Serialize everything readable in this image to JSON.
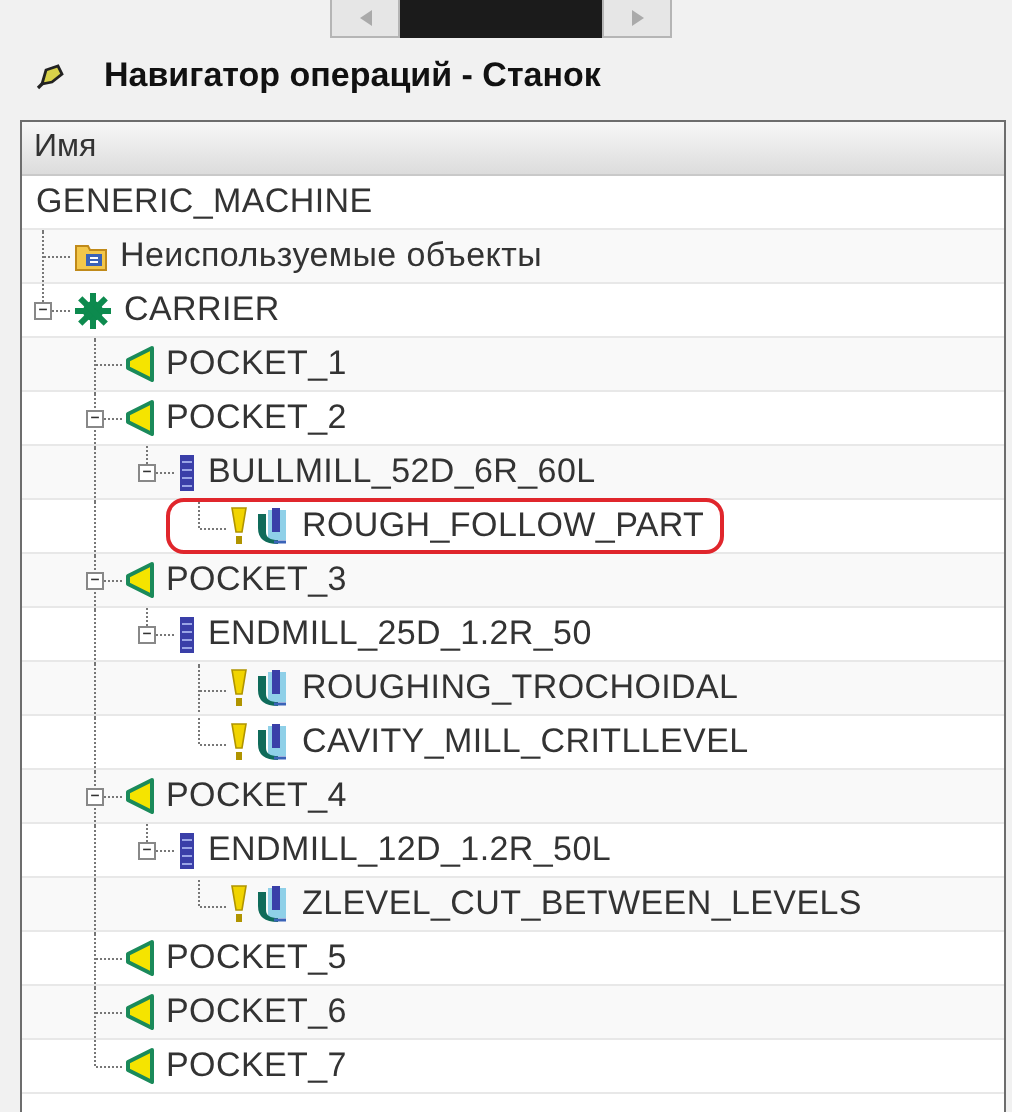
{
  "navigator": {
    "title": "Навигатор операций - Станок"
  },
  "tree": {
    "column": "Имя",
    "root": {
      "label": "GENERIC_MACHINE",
      "children": [
        {
          "kind": "unused",
          "label": "Неиспользуемые объекты"
        },
        {
          "kind": "carrier",
          "label": "CARRIER",
          "expanded": true,
          "children": [
            {
              "kind": "geometry",
              "label": "POCKET_1"
            },
            {
              "kind": "geometry",
              "label": "POCKET_2",
              "expanded": true,
              "children": [
                {
                  "kind": "tool",
                  "label": "BULLMILL_52D_6R_60L",
                  "expanded": true,
                  "children": [
                    {
                      "kind": "operation",
                      "label": "ROUGH_FOLLOW_PART",
                      "highlighted": true
                    }
                  ]
                }
              ]
            },
            {
              "kind": "geometry",
              "label": "POCKET_3",
              "expanded": true,
              "children": [
                {
                  "kind": "tool",
                  "label": "ENDMILL_25D_1.2R_50",
                  "expanded": true,
                  "children": [
                    {
                      "kind": "operation",
                      "label": "ROUGHING_TROCHOIDAL",
                      "highlighted": false
                    },
                    {
                      "kind": "operation",
                      "label": "CAVITY_MILL_CRITLLEVEL",
                      "highlighted": false
                    }
                  ]
                }
              ]
            },
            {
              "kind": "geometry",
              "label": "POCKET_4",
              "expanded": true,
              "children": [
                {
                  "kind": "tool",
                  "label": "ENDMILL_12D_1.2R_50L",
                  "expanded": true,
                  "children": [
                    {
                      "kind": "operation",
                      "label": "ZLEVEL_CUT_BETWEEN_LEVELS",
                      "highlighted": false
                    }
                  ]
                }
              ]
            },
            {
              "kind": "geometry",
              "label": "POCKET_5"
            },
            {
              "kind": "geometry",
              "label": "POCKET_6"
            },
            {
              "kind": "geometry",
              "label": "POCKET_7"
            }
          ]
        }
      ]
    }
  }
}
